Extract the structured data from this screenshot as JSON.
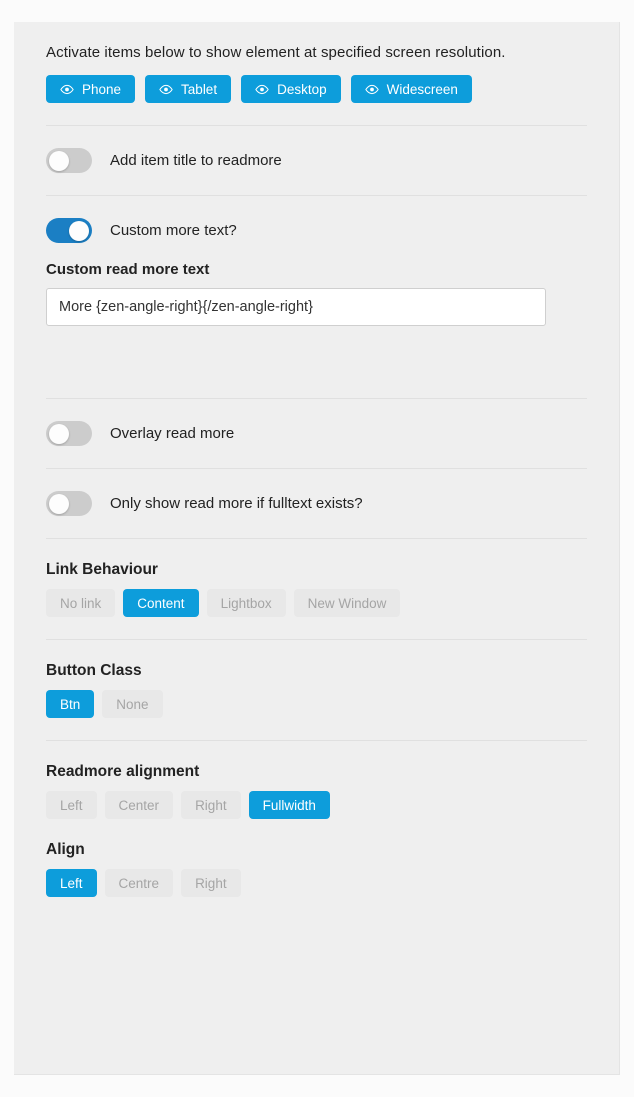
{
  "intro": {
    "text": "Activate items below to show element at specified screen resolution.",
    "buttons": [
      {
        "label": "Phone",
        "icon": "eye-icon"
      },
      {
        "label": "Tablet",
        "icon": "eye-icon"
      },
      {
        "label": "Desktop",
        "icon": "eye-icon"
      },
      {
        "label": "Widescreen",
        "icon": "eye-icon"
      }
    ]
  },
  "toggles": [
    {
      "label": "Add item title to readmore",
      "state": "off"
    },
    {
      "label": "Custom more text?",
      "state": "on"
    },
    {
      "label": "Overlay read more",
      "state": "off"
    },
    {
      "label": "Only show read more if fulltext exists?",
      "state": "off"
    }
  ],
  "custom_text_field": {
    "label": "Custom read more text",
    "value": "More {zen-angle-right}{/zen-angle-right}",
    "placeholder": ""
  },
  "option_groups": [
    {
      "title": "Link Behaviour",
      "options": [
        "No link",
        "Content",
        "Lightbox",
        "New Window"
      ],
      "selected": "Content"
    },
    {
      "title": "Button Class",
      "options": [
        "Btn",
        "None"
      ],
      "selected": "Btn"
    },
    {
      "title": "Readmore alignment",
      "options": [
        "Left",
        "Center",
        "Right",
        "Fullwidth"
      ],
      "selected": "Fullwidth"
    },
    {
      "title": "Align",
      "options": [
        "Left",
        "Centre",
        "Right"
      ],
      "selected": "Left"
    }
  ],
  "colors": {
    "accent": "#0d9ddb",
    "toggle_on": "#1b7fc4",
    "toggle_off": "#cccccc",
    "panel_bg": "#efefef",
    "pill_inactive_bg": "#e8e8e8",
    "pill_inactive_text": "#a5a5a5"
  }
}
